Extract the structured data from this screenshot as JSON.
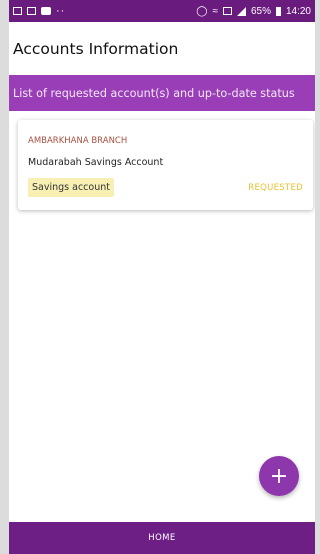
{
  "status_bar": {
    "left_dots": "··",
    "battery_percent": "65%",
    "time": "14:20"
  },
  "app_bar": {
    "title": "Accounts Information"
  },
  "banner": {
    "text": "List of requested account(s) and up-to-date status"
  },
  "accounts": [
    {
      "branch": "AMBARKHANA BRANCH",
      "account_name": "Mudarabah Savings Account",
      "account_type": "Savings account",
      "status": "REQUESTED"
    }
  ],
  "fab": {
    "label": "+"
  },
  "bottom_nav": {
    "home_label": "HOME"
  },
  "colors": {
    "status_bar": "#6a1b7e",
    "banner": "#9a3eb7",
    "status_requested": "#e8c22c",
    "badge_bg": "#f8efb3",
    "fab": "#8e36ac",
    "bottom_nav": "#6e1f86"
  },
  "icons": {
    "status_left": [
      "gallery-icon",
      "image-icon",
      "message-icon"
    ],
    "status_right": [
      "alarm-icon",
      "wifi-icon",
      "data-icon",
      "signal-icon",
      "battery-icon"
    ]
  }
}
